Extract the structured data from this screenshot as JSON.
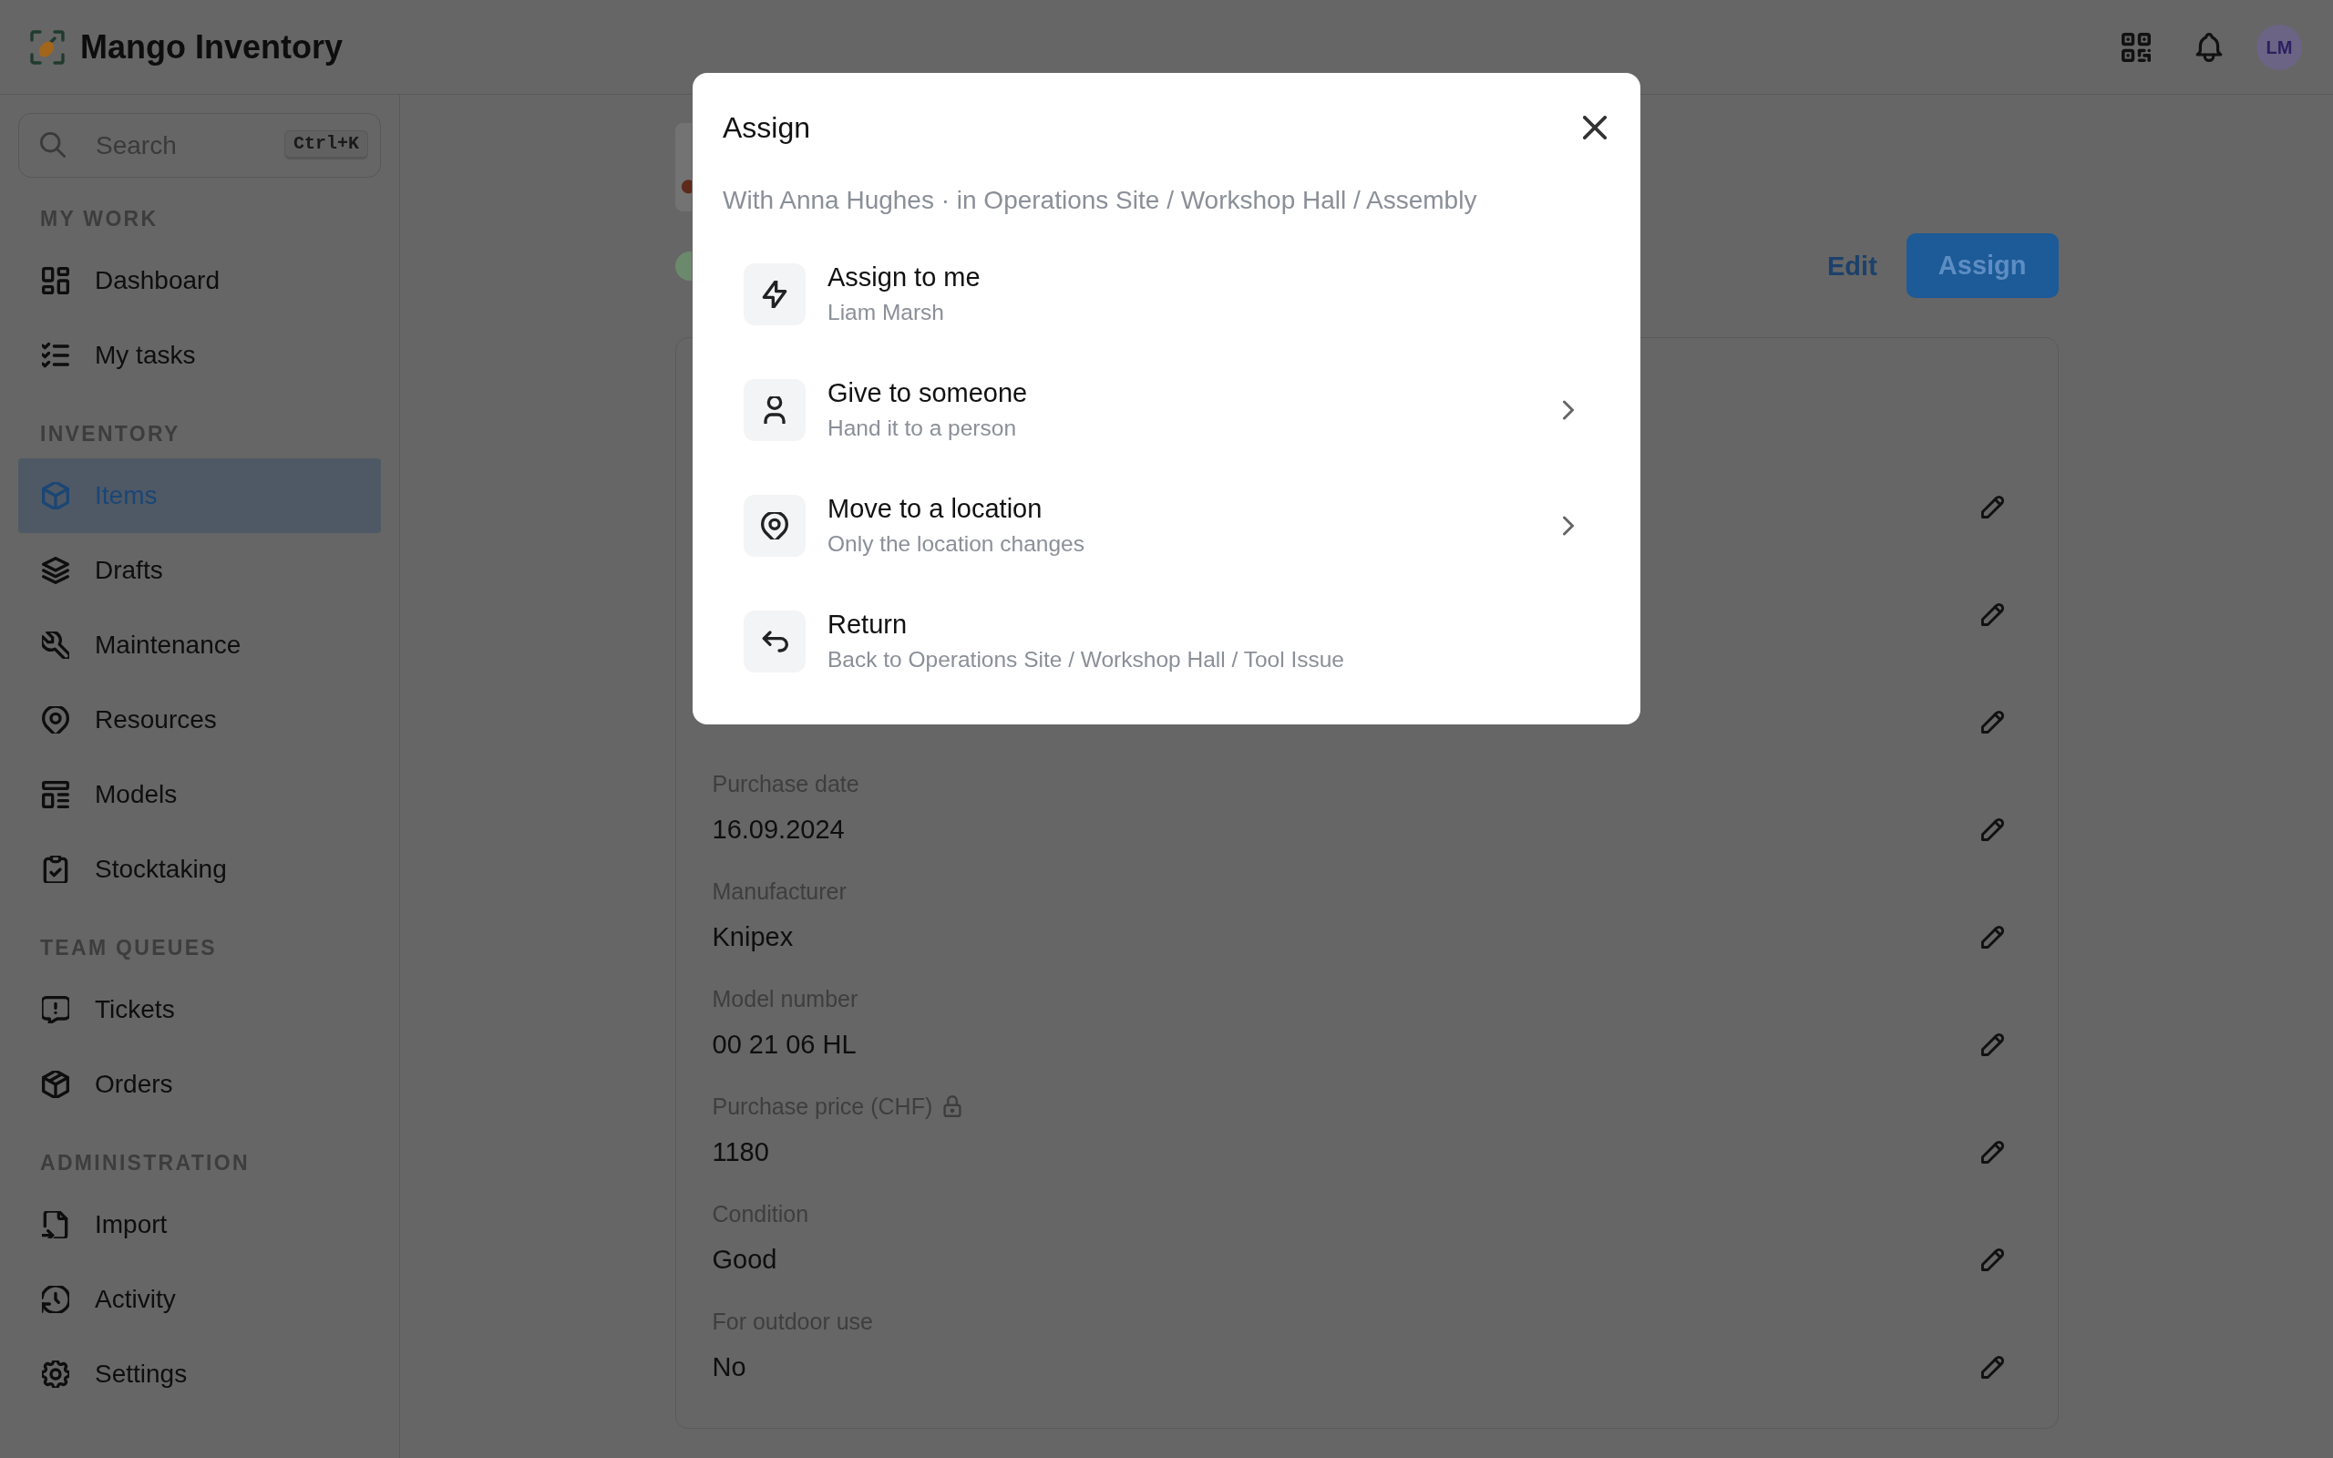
{
  "header": {
    "title": "Mango Inventory",
    "avatar": "LM"
  },
  "sidebar": {
    "search": {
      "placeholder": "Search",
      "shortcut": "Ctrl+K"
    },
    "sections": [
      {
        "heading": "MY WORK",
        "items": [
          {
            "label": "Dashboard",
            "selected": false
          },
          {
            "label": "My tasks",
            "selected": false
          }
        ]
      },
      {
        "heading": "INVENTORY",
        "items": [
          {
            "label": "Items",
            "selected": true
          },
          {
            "label": "Drafts",
            "selected": false
          },
          {
            "label": "Maintenance",
            "selected": false
          },
          {
            "label": "Resources",
            "selected": false
          },
          {
            "label": "Models",
            "selected": false
          },
          {
            "label": "Stocktaking",
            "selected": false
          }
        ]
      },
      {
        "heading": "TEAM QUEUES",
        "items": [
          {
            "label": "Tickets",
            "selected": false
          },
          {
            "label": "Orders",
            "selected": false
          }
        ]
      },
      {
        "heading": "ADMINISTRATION",
        "items": [
          {
            "label": "Import",
            "selected": false
          },
          {
            "label": "Activity",
            "selected": false
          },
          {
            "label": "Settings",
            "selected": false
          }
        ]
      }
    ]
  },
  "page": {
    "actions": [
      {
        "label": "Edit",
        "kind": "link"
      },
      {
        "label": "Assign",
        "kind": "primary"
      }
    ],
    "fields": [
      {
        "editable": true
      },
      {
        "editable": true
      },
      {
        "editable": true
      },
      {
        "label": "Purchase date",
        "value": "16.09.2024",
        "editable": true,
        "locked": false
      },
      {
        "label": "Manufacturer",
        "value": "Knipex",
        "editable": true,
        "locked": false
      },
      {
        "label": "Model number",
        "value": "00 21 06 HL",
        "editable": true,
        "locked": false
      },
      {
        "label": "Purchase price (CHF)",
        "value": "1180",
        "editable": true,
        "locked": true
      },
      {
        "label": "Condition",
        "value": "Good",
        "editable": true,
        "locked": false
      },
      {
        "label": "For outdoor use",
        "value": "No",
        "editable": true,
        "locked": false
      }
    ]
  },
  "modal": {
    "title": "Assign",
    "subtitle": "With Anna Hughes · in Operations Site / Workshop Hall / Assembly",
    "options": [
      {
        "title": "Assign to me",
        "description": "Liam Marsh",
        "opens_submenu": false
      },
      {
        "title": "Give to someone",
        "description": "Hand it to a person",
        "opens_submenu": true
      },
      {
        "title": "Move to a location",
        "description": "Only the location changes",
        "opens_submenu": true
      },
      {
        "title": "Return",
        "description": "Back to Operations Site / Workshop Hall / Tool Issue",
        "opens_submenu": false
      }
    ]
  }
}
